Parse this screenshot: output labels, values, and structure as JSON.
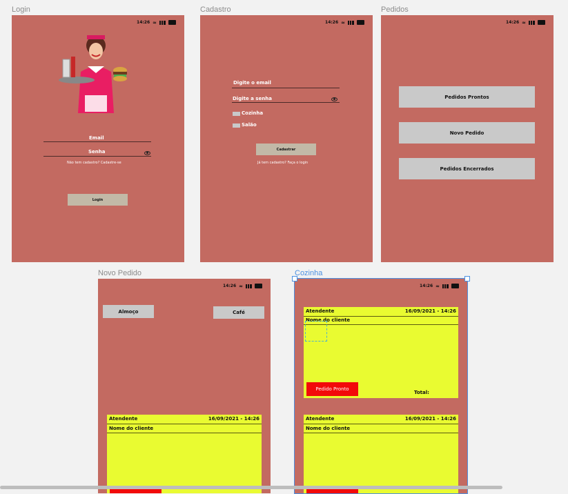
{
  "frames": {
    "login": {
      "label": "Login",
      "email_label": "Email",
      "password_label": "Senha",
      "signup_hint": "Não tem cadastro? Cadastre-se",
      "login_button": "Login"
    },
    "cadastro": {
      "label": "Cadastro",
      "email_label": "Digite o email",
      "password_label": "Digite a senha",
      "kitchen_option": "Cozinha",
      "hall_option": "Salão",
      "register_button": "Cadastrar",
      "login_hint": "Já tem cadastro? Faça o login"
    },
    "pedidos": {
      "label": "Pedidos",
      "ready_button": "Pedidos Prontos",
      "new_button": "Novo Pedido",
      "closed_button": "Pedidos Encerrados"
    },
    "novo_pedido": {
      "label": "Novo Pedido",
      "lunch_button": "Almoço",
      "coffee_button": "Café",
      "card": {
        "attendant": "Atendente",
        "datetime": "16/09/2021 - 14:26",
        "client": "Nome do cliente"
      }
    },
    "cozinha": {
      "label": "Cozinha",
      "card1": {
        "attendant": "Atendente",
        "datetime": "16/09/2021 - 14:26",
        "client": "Nome do cliente",
        "ready_button": "Pedido Pronto",
        "total": "Total:"
      },
      "card2": {
        "attendant": "Atendente",
        "datetime": "16/09/2021 - 14:26",
        "client": "Nome do cliente"
      }
    }
  },
  "status_time": "14:26",
  "colors": {
    "frame_bg": "#c36a61",
    "card_bg": "#e9fb31",
    "button_gray": "#c9c9c9",
    "button_red": "#f20a0a",
    "selection": "#4a90e2"
  }
}
